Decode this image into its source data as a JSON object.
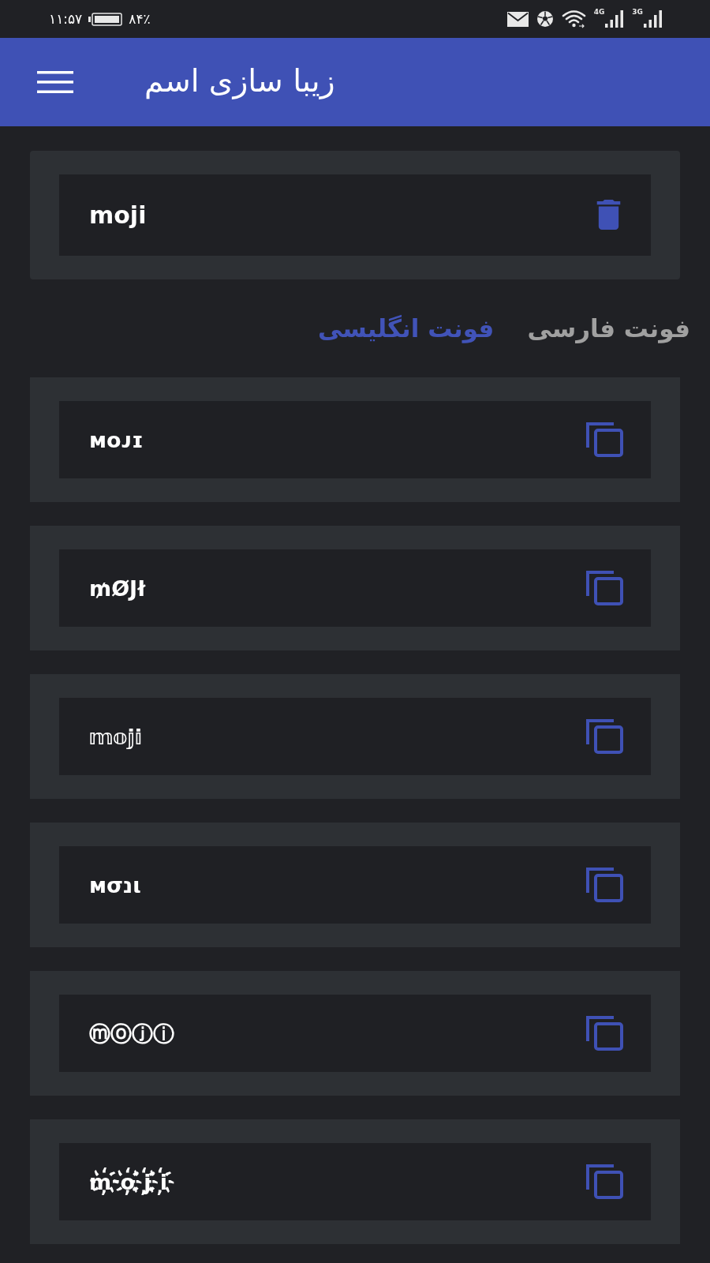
{
  "status_bar": {
    "time": "۱۱:۵۷",
    "battery": "۸۴٪",
    "networks": [
      {
        "label": "3G"
      },
      {
        "label": "4G"
      }
    ]
  },
  "app_bar": {
    "title": "زیبا سازی اسم"
  },
  "name_field": {
    "value": "moji"
  },
  "tabs": [
    {
      "label": "فونت فارسی",
      "selected": false
    },
    {
      "label": "فونت انگلیسی",
      "selected": true
    }
  ],
  "results": [
    {
      "text": "ᴍᴏᴊɪ"
    },
    {
      "text": "₥ØJł"
    },
    {
      "text": "𝕞𝕠𝕛𝕚"
    },
    {
      "text": "мσנι"
    },
    {
      "text": "ⓜⓞⓙⓘ"
    },
    {
      "text": "m҉o҉j҉i҉"
    }
  ]
}
